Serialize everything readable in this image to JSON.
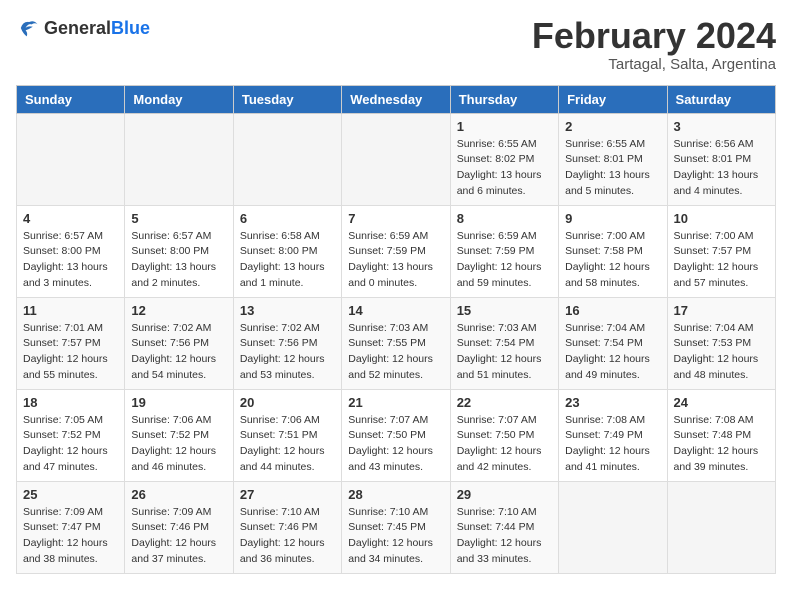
{
  "logo": {
    "general": "General",
    "blue": "Blue"
  },
  "title": "February 2024",
  "subtitle": "Tartagal, Salta, Argentina",
  "headers": [
    "Sunday",
    "Monday",
    "Tuesday",
    "Wednesday",
    "Thursday",
    "Friday",
    "Saturday"
  ],
  "weeks": [
    [
      {
        "day": "",
        "info": ""
      },
      {
        "day": "",
        "info": ""
      },
      {
        "day": "",
        "info": ""
      },
      {
        "day": "",
        "info": ""
      },
      {
        "day": "1",
        "info": "Sunrise: 6:55 AM\nSunset: 8:02 PM\nDaylight: 13 hours and 6 minutes."
      },
      {
        "day": "2",
        "info": "Sunrise: 6:55 AM\nSunset: 8:01 PM\nDaylight: 13 hours and 5 minutes."
      },
      {
        "day": "3",
        "info": "Sunrise: 6:56 AM\nSunset: 8:01 PM\nDaylight: 13 hours and 4 minutes."
      }
    ],
    [
      {
        "day": "4",
        "info": "Sunrise: 6:57 AM\nSunset: 8:00 PM\nDaylight: 13 hours and 3 minutes."
      },
      {
        "day": "5",
        "info": "Sunrise: 6:57 AM\nSunset: 8:00 PM\nDaylight: 13 hours and 2 minutes."
      },
      {
        "day": "6",
        "info": "Sunrise: 6:58 AM\nSunset: 8:00 PM\nDaylight: 13 hours and 1 minute."
      },
      {
        "day": "7",
        "info": "Sunrise: 6:59 AM\nSunset: 7:59 PM\nDaylight: 13 hours and 0 minutes."
      },
      {
        "day": "8",
        "info": "Sunrise: 6:59 AM\nSunset: 7:59 PM\nDaylight: 12 hours and 59 minutes."
      },
      {
        "day": "9",
        "info": "Sunrise: 7:00 AM\nSunset: 7:58 PM\nDaylight: 12 hours and 58 minutes."
      },
      {
        "day": "10",
        "info": "Sunrise: 7:00 AM\nSunset: 7:57 PM\nDaylight: 12 hours and 57 minutes."
      }
    ],
    [
      {
        "day": "11",
        "info": "Sunrise: 7:01 AM\nSunset: 7:57 PM\nDaylight: 12 hours and 55 minutes."
      },
      {
        "day": "12",
        "info": "Sunrise: 7:02 AM\nSunset: 7:56 PM\nDaylight: 12 hours and 54 minutes."
      },
      {
        "day": "13",
        "info": "Sunrise: 7:02 AM\nSunset: 7:56 PM\nDaylight: 12 hours and 53 minutes."
      },
      {
        "day": "14",
        "info": "Sunrise: 7:03 AM\nSunset: 7:55 PM\nDaylight: 12 hours and 52 minutes."
      },
      {
        "day": "15",
        "info": "Sunrise: 7:03 AM\nSunset: 7:54 PM\nDaylight: 12 hours and 51 minutes."
      },
      {
        "day": "16",
        "info": "Sunrise: 7:04 AM\nSunset: 7:54 PM\nDaylight: 12 hours and 49 minutes."
      },
      {
        "day": "17",
        "info": "Sunrise: 7:04 AM\nSunset: 7:53 PM\nDaylight: 12 hours and 48 minutes."
      }
    ],
    [
      {
        "day": "18",
        "info": "Sunrise: 7:05 AM\nSunset: 7:52 PM\nDaylight: 12 hours and 47 minutes."
      },
      {
        "day": "19",
        "info": "Sunrise: 7:06 AM\nSunset: 7:52 PM\nDaylight: 12 hours and 46 minutes."
      },
      {
        "day": "20",
        "info": "Sunrise: 7:06 AM\nSunset: 7:51 PM\nDaylight: 12 hours and 44 minutes."
      },
      {
        "day": "21",
        "info": "Sunrise: 7:07 AM\nSunset: 7:50 PM\nDaylight: 12 hours and 43 minutes."
      },
      {
        "day": "22",
        "info": "Sunrise: 7:07 AM\nSunset: 7:50 PM\nDaylight: 12 hours and 42 minutes."
      },
      {
        "day": "23",
        "info": "Sunrise: 7:08 AM\nSunset: 7:49 PM\nDaylight: 12 hours and 41 minutes."
      },
      {
        "day": "24",
        "info": "Sunrise: 7:08 AM\nSunset: 7:48 PM\nDaylight: 12 hours and 39 minutes."
      }
    ],
    [
      {
        "day": "25",
        "info": "Sunrise: 7:09 AM\nSunset: 7:47 PM\nDaylight: 12 hours and 38 minutes."
      },
      {
        "day": "26",
        "info": "Sunrise: 7:09 AM\nSunset: 7:46 PM\nDaylight: 12 hours and 37 minutes."
      },
      {
        "day": "27",
        "info": "Sunrise: 7:10 AM\nSunset: 7:46 PM\nDaylight: 12 hours and 36 minutes."
      },
      {
        "day": "28",
        "info": "Sunrise: 7:10 AM\nSunset: 7:45 PM\nDaylight: 12 hours and 34 minutes."
      },
      {
        "day": "29",
        "info": "Sunrise: 7:10 AM\nSunset: 7:44 PM\nDaylight: 12 hours and 33 minutes."
      },
      {
        "day": "",
        "info": ""
      },
      {
        "day": "",
        "info": ""
      }
    ]
  ]
}
